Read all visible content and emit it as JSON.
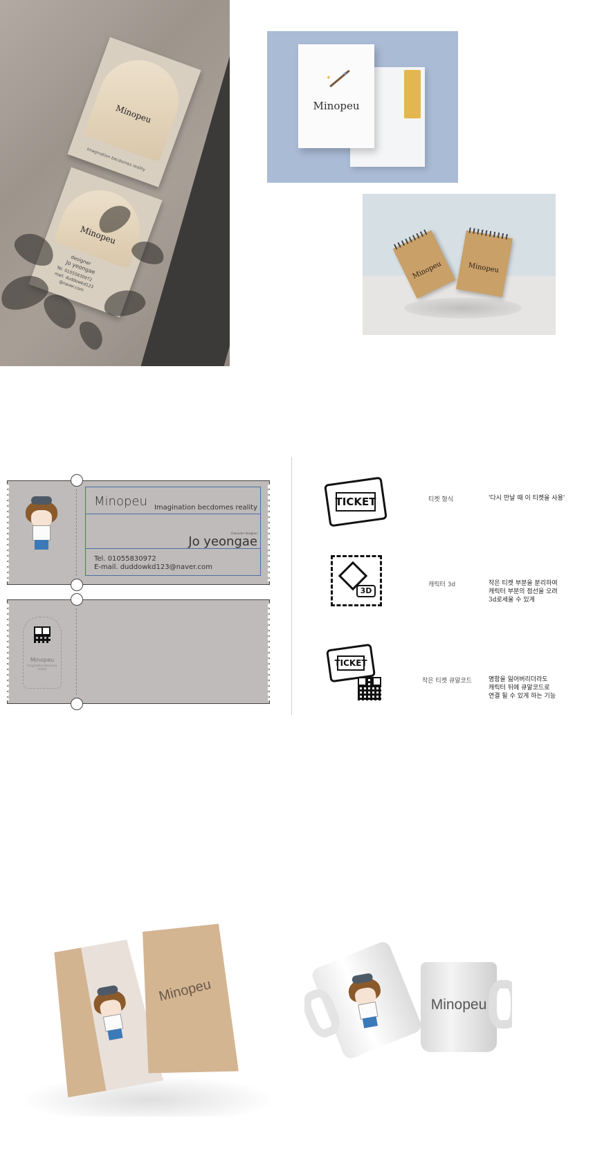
{
  "mockups": {
    "business_card": {
      "brand": "Minopeu",
      "tagline": "Imagination becdomes reality",
      "back_brand": "Minopeu",
      "back_role": "designer",
      "back_name": "Jo yeongae",
      "back_tel": "Tel. 01055830972",
      "back_email": "mail. duddowkd123",
      "back_domain": "@naver.com"
    },
    "envelope": {
      "brand": "Minopeu",
      "background_color": "#aabbd6",
      "seal_color": "#e3b64f"
    },
    "notebook": {
      "left_label": "Minopeu",
      "right_label": "Minopeu",
      "pad_color": "#c9a068"
    }
  },
  "ticket": {
    "brand": "Minopeu",
    "tagline": "Imagination becdomes reality",
    "role": "Character designer",
    "name": "Jo yeongae",
    "tel": "Tel. 01055830972",
    "email": "E-mail. duddowkd123@naver.com",
    "back_brand": "Minopeu",
    "back_tagline": "Imagination becomes reality",
    "ticket_color": "#bebbba",
    "frame_color": "#4a6ea0"
  },
  "legend": [
    {
      "icon": "ticket-icon",
      "icon_text": "TICKET",
      "label": "티켓 형식",
      "desc": "'다시 만날 때 이 티켓을 사용'"
    },
    {
      "icon": "cube-3d-icon",
      "icon_text": "3D",
      "label": "캐릭터 3d",
      "desc": "작은 티켓 부분을 분리하여\n캐릭터 부분의 점선을 오려\n3d로세울 수 있게"
    },
    {
      "icon": "ticket-qr-icon",
      "icon_text": "TICKET",
      "label": "작은 티켓 큐알코드",
      "desc": "명함을 잃어버리더라도\n캐릭터 뒤에 큐알코드로\n연결 될 수 있게 하는 기능"
    }
  ],
  "products": {
    "pouch_label": "Minopeu",
    "mug_label": "Minopeu",
    "pouch_color": "#d4b592"
  }
}
